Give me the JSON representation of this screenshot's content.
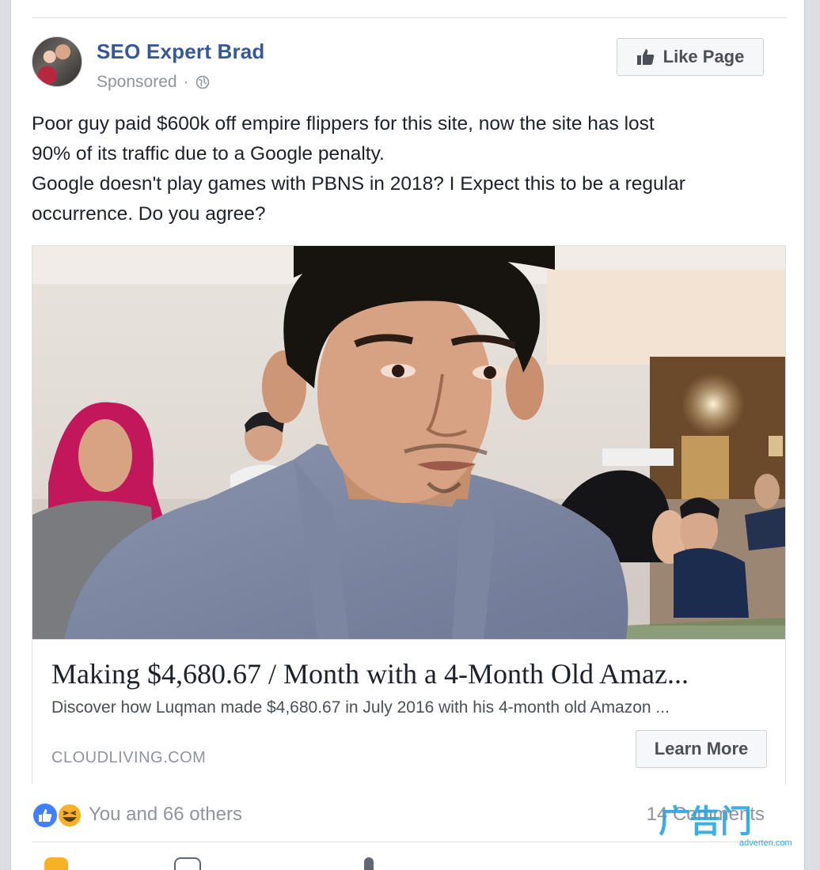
{
  "post": {
    "page_name": "SEO Expert Brad",
    "sponsored_label": "Sponsored",
    "separator": "·",
    "like_page_label": "Like Page",
    "text_lines": [
      "Poor guy paid $600k off empire flippers for this site, now the site has lost",
      "90% of its traffic due to a Google penalty.",
      "Google doesn't play games with PBNS in 2018? I Expect this to be a regular",
      "occurrence. Do you agree?"
    ]
  },
  "link_preview": {
    "title": "Making $4,680.67 / Month with a 4-Month Old Amaz...",
    "description": "Discover how Luqman made $4,680.67 in July 2016 with his 4-month old Amazon ...",
    "domain": "CLOUDLIVING.COM",
    "cta_label": "Learn More"
  },
  "engagement": {
    "reactions_text": "You and 66 others",
    "reaction_types": [
      "like-icon",
      "haha-icon"
    ],
    "comments_text": "14 Comments"
  },
  "watermark": {
    "main": "广告门",
    "sub": "adverten.com"
  },
  "colors": {
    "link_blue": "#365899",
    "like_blue": "#4080ff",
    "haha_yellow": "#f7b125",
    "muted_gray": "#90949c",
    "watermark_blue": "#2da7e0"
  }
}
